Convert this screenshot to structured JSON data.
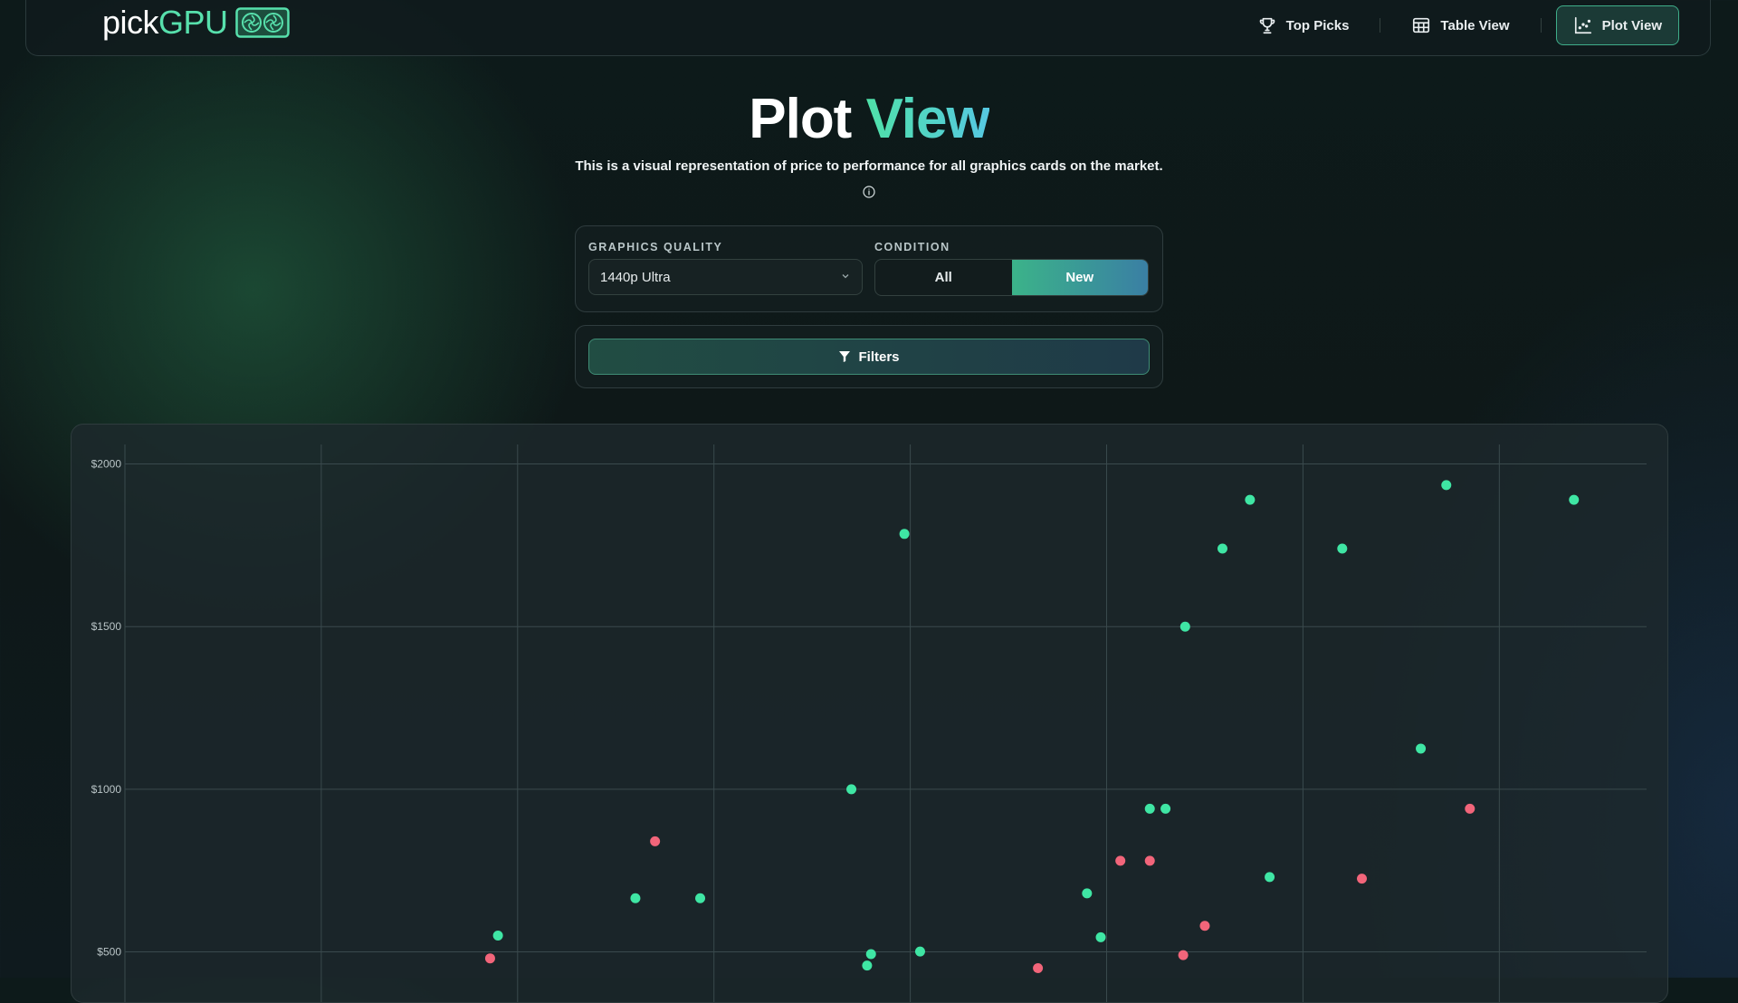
{
  "app": {
    "logo_pick": "pick",
    "logo_gpu": "GPU",
    "logo_icon": "gpu-card-icon"
  },
  "nav": {
    "items": [
      {
        "label": "Top Picks",
        "icon": "trophy-icon",
        "active": false
      },
      {
        "label": "Table View",
        "icon": "table-icon",
        "active": false
      },
      {
        "label": "Plot View",
        "icon": "scatter-plot-icon",
        "active": true
      }
    ]
  },
  "hero": {
    "title_part1": "Plot",
    "title_part2": "View",
    "subtitle": "This is a visual representation of price to performance for all graphics cards on the market.",
    "info_icon": "info-icon"
  },
  "controls": {
    "quality_label": "GRAPHICS QUALITY",
    "quality_value": "1440p Ultra",
    "condition_label": "CONDITION",
    "condition_options": [
      "All",
      "New"
    ],
    "condition_selected": "New",
    "filters_label": "Filters",
    "filters_icon": "filter-icon"
  },
  "colors": {
    "accent_green": "#57e0ac",
    "point_good": "#3fe6a4",
    "point_bad": "#f2657a",
    "grid": "#3a4a4d"
  },
  "chart_data": {
    "type": "scatter",
    "title": "",
    "xlabel": "",
    "ylabel": "",
    "y_ticks": [
      "$2000",
      "$1500",
      "$1000",
      "$500"
    ],
    "y_tick_values": [
      2000,
      1500,
      1000,
      500
    ],
    "xlim": [
      0,
      7.75
    ],
    "ylim": [
      340,
      2060
    ],
    "x_gridlines": 8,
    "grid": true,
    "series": [
      {
        "color": "#3fe6a4",
        "points": [
          [
            1.9,
            550
          ],
          [
            2.6,
            665
          ],
          [
            2.93,
            665
          ],
          [
            3.7,
            1000
          ],
          [
            3.97,
            1785
          ],
          [
            3.8,
            493
          ],
          [
            4.05,
            501
          ],
          [
            3.78,
            458
          ],
          [
            4.9,
            680
          ],
          [
            4.97,
            545
          ],
          [
            5.22,
            940
          ],
          [
            5.3,
            940
          ],
          [
            5.4,
            1500
          ],
          [
            5.59,
            1740
          ],
          [
            5.73,
            1890
          ],
          [
            5.83,
            730
          ],
          [
            6.2,
            1740
          ],
          [
            6.6,
            1125
          ],
          [
            6.73,
            1935
          ],
          [
            7.38,
            1890
          ]
        ]
      },
      {
        "color": "#f2657a",
        "points": [
          [
            1.86,
            480
          ],
          [
            2.7,
            840
          ],
          [
            4.65,
            450
          ],
          [
            5.07,
            780
          ],
          [
            5.22,
            780
          ],
          [
            5.39,
            490
          ],
          [
            5.5,
            580
          ],
          [
            6.3,
            725
          ],
          [
            6.85,
            940
          ]
        ]
      }
    ]
  }
}
